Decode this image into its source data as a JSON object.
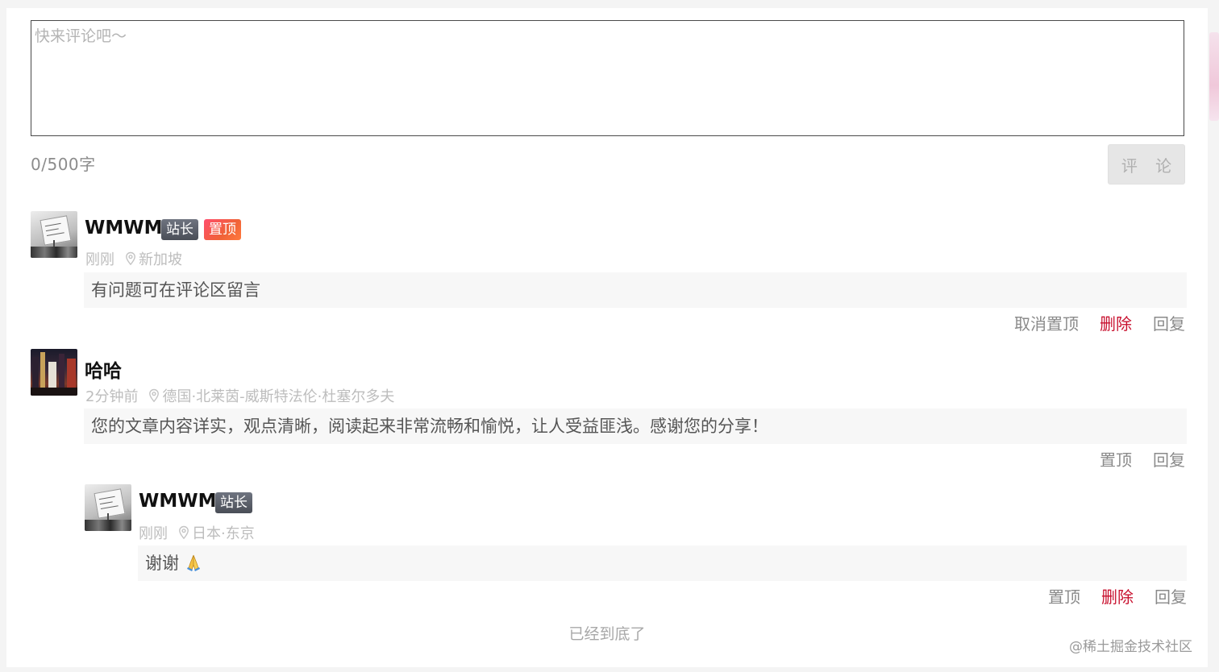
{
  "composer": {
    "placeholder": "快来评论吧～",
    "value": "",
    "counter": "0/500字",
    "submit_label": "评 论"
  },
  "comments": [
    {
      "user": "WMWM",
      "badges": [
        "站长",
        "置顶"
      ],
      "time": "刚刚",
      "location": "新加坡",
      "text": "有问题可在评论区留言",
      "actions": [
        "取消置顶",
        "删除",
        "回复"
      ],
      "avatar": "sign-protest-avatar"
    },
    {
      "user": "哈哈",
      "badges": [],
      "time": "2分钟前",
      "location": "德国·北莱茵-威斯特法伦·杜塞尔多夫",
      "text": "您的文章内容详实，观点清晰，阅读起来非常流畅和愉悦，让人受益匪浅。感谢您的分享！",
      "actions": [
        "置顶",
        "回复"
      ],
      "avatar": "city-night-avatar"
    },
    {
      "user": "WMWM",
      "badges": [
        "站长"
      ],
      "time": "刚刚",
      "location": "日本·东京",
      "text": "谢谢",
      "emoji": "folded-hands-icon",
      "actions": [
        "置顶",
        "删除",
        "回复"
      ],
      "avatar": "sign-protest-avatar"
    }
  ],
  "footer": {
    "end_text": "已经到底了",
    "watermark": "@稀土掘金技术社区"
  },
  "colors": {
    "danger": "#c8102e",
    "admin_badge": "#4a4e57",
    "top_badge": "#f0523a",
    "muted": "#bdbdbd"
  }
}
